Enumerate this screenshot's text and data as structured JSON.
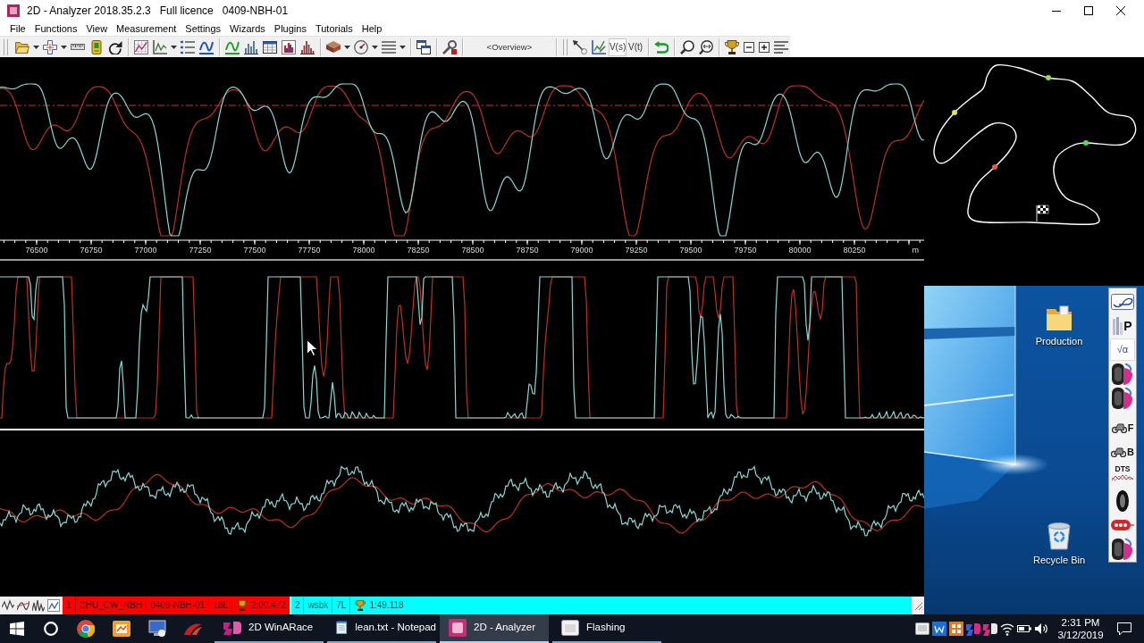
{
  "window": {
    "title": "2D - Analyzer 2018.35.2.3   Full licence   0409-NBH-01"
  },
  "menu": [
    "File",
    "Functions",
    "View",
    "Measurement",
    "Settings",
    "Wizards",
    "Plugins",
    "Tutorials",
    "Help"
  ],
  "toolbar": {
    "view_field": "<Overview>",
    "text_buttons": [
      {
        "label": "V(s)",
        "pressed": true
      },
      {
        "label": "V(t)",
        "pressed": false
      }
    ]
  },
  "distance_axis": {
    "ticks": [
      "76500",
      "76750",
      "77000",
      "77250",
      "77500",
      "77750",
      "78000",
      "78250",
      "78500",
      "78750",
      "79000",
      "79250",
      "79500",
      "79750",
      "80000",
      "80250"
    ],
    "unit": "m"
  },
  "status_bar": {
    "sessions": [
      {
        "color": "#ff0000",
        "fields": [
          "1",
          "CHU_CW_NBH",
          "0409-NBH-01",
          "18L"
        ],
        "trophy_time": "2:00.472"
      },
      {
        "color": "#00ffff",
        "fields": [
          "2",
          "wsbk",
          "7L"
        ],
        "trophy_time": "1:49.118"
      }
    ]
  },
  "track_map": {
    "markers": [
      {
        "color": "#8ee04a"
      },
      {
        "color": "#e6e640"
      },
      {
        "color": "#58d858"
      },
      {
        "color": "#e05a50"
      }
    ]
  },
  "desktop": {
    "icons": [
      {
        "kind": "folder",
        "label": "Production"
      },
      {
        "kind": "recycle-bin",
        "label": "Recycle Bin"
      }
    ],
    "launcher": [
      {
        "kind": "track"
      },
      {
        "kind": "letter",
        "label": "P"
      },
      {
        "kind": "formula",
        "label": "√α"
      },
      {
        "kind": "tyre"
      },
      {
        "kind": "tyre"
      },
      {
        "kind": "bike",
        "label": "F"
      },
      {
        "kind": "bike",
        "label": "B"
      },
      {
        "kind": "chart",
        "label": "DTS"
      },
      {
        "kind": "wheel"
      },
      {
        "kind": "tag"
      },
      {
        "kind": "tyre"
      }
    ]
  },
  "taskbar": {
    "apps": [
      {
        "label": "2D WinARace",
        "selected": false
      },
      {
        "label": "lean.txt - Notepad",
        "selected": false
      },
      {
        "label": "2D - Analyzer",
        "selected": true
      },
      {
        "label": "Flashing",
        "selected": false
      }
    ],
    "clock": {
      "time": "2:31 PM",
      "date": "3/12/2019"
    }
  }
}
